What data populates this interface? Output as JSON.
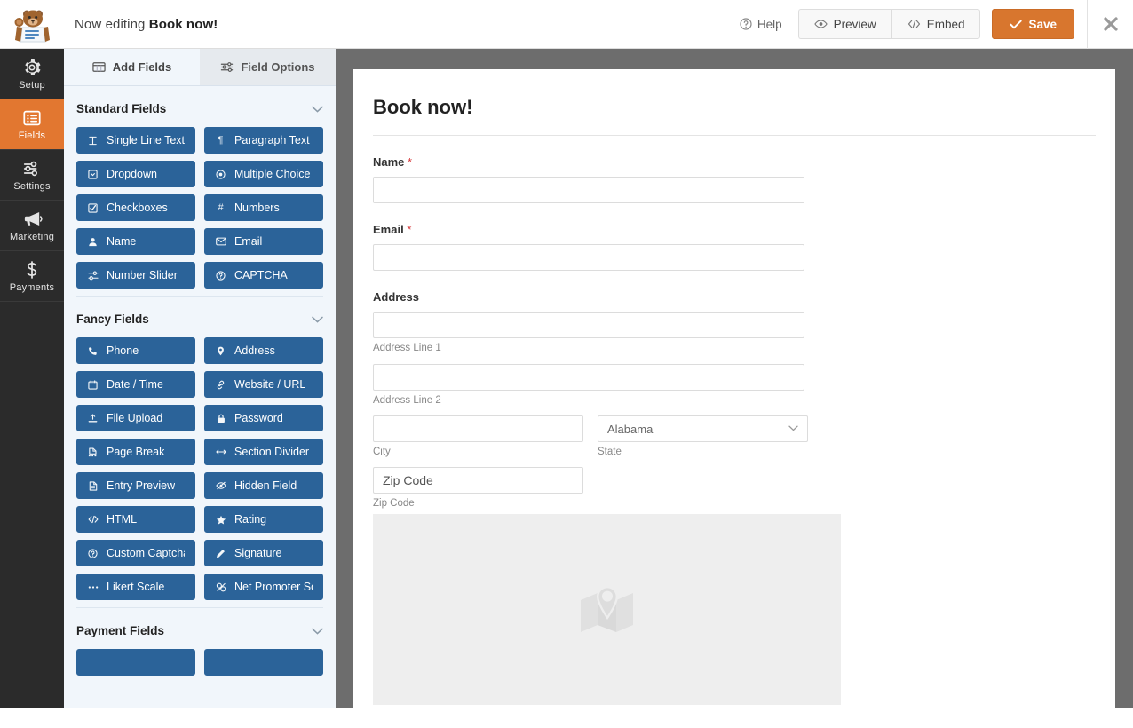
{
  "colors": {
    "accent_orange": "#d8762e",
    "rail_active": "#e27730",
    "field_blue": "#2b6399",
    "panel_bg": "#f1f6fb",
    "gutter_gray": "#6d6d6d",
    "required_red": "#d63638"
  },
  "topbar": {
    "logo_name": "wpforms-sullie-mascot",
    "editing_prefix": "Now editing",
    "form_name": "Book now!",
    "help_label": "Help",
    "preview_label": "Preview",
    "embed_label": "Embed",
    "save_label": "Save",
    "close_label": "✖"
  },
  "rail": {
    "items": [
      {
        "label": "Setup",
        "icon": "gear-icon",
        "active": false
      },
      {
        "label": "Fields",
        "icon": "list-icon",
        "active": true
      },
      {
        "label": "Settings",
        "icon": "sliders-icon",
        "active": false
      },
      {
        "label": "Marketing",
        "icon": "megaphone-icon",
        "active": false
      },
      {
        "label": "Payments",
        "icon": "dollar-icon",
        "active": false
      }
    ]
  },
  "panel": {
    "tabs": [
      {
        "label": "Add Fields",
        "icon": "add-fields-icon",
        "active": true
      },
      {
        "label": "Field Options",
        "icon": "sliders-icon",
        "active": false
      }
    ],
    "sections": [
      {
        "title": "Standard Fields",
        "collapse_icon": "chevron-down-icon",
        "fields": [
          {
            "label": "Single Line Text",
            "icon": "text-cursor-icon"
          },
          {
            "label": "Paragraph Text",
            "icon": "pilcrow-icon"
          },
          {
            "label": "Dropdown",
            "icon": "dropdown-icon"
          },
          {
            "label": "Multiple Choice",
            "icon": "radio-icon"
          },
          {
            "label": "Checkboxes",
            "icon": "checkbox-icon"
          },
          {
            "label": "Numbers",
            "icon": "hash-icon"
          },
          {
            "label": "Name",
            "icon": "user-icon"
          },
          {
            "label": "Email",
            "icon": "envelope-icon"
          },
          {
            "label": "Number Slider",
            "icon": "slider-icon"
          },
          {
            "label": "CAPTCHA",
            "icon": "question-circle-icon"
          }
        ]
      },
      {
        "title": "Fancy Fields",
        "collapse_icon": "chevron-down-icon",
        "fields": [
          {
            "label": "Phone",
            "icon": "phone-icon"
          },
          {
            "label": "Address",
            "icon": "map-pin-icon"
          },
          {
            "label": "Date / Time",
            "icon": "calendar-icon"
          },
          {
            "label": "Website / URL",
            "icon": "link-icon"
          },
          {
            "label": "File Upload",
            "icon": "upload-icon"
          },
          {
            "label": "Password",
            "icon": "lock-icon"
          },
          {
            "label": "Page Break",
            "icon": "page-break-icon"
          },
          {
            "label": "Section Divider",
            "icon": "arrows-horizontal-icon"
          },
          {
            "label": "Entry Preview",
            "icon": "document-icon"
          },
          {
            "label": "Hidden Field",
            "icon": "eye-slash-icon"
          },
          {
            "label": "HTML",
            "icon": "code-icon"
          },
          {
            "label": "Rating",
            "icon": "star-icon"
          },
          {
            "label": "Custom Captcha",
            "icon": "question-circle-icon"
          },
          {
            "label": "Signature",
            "icon": "pen-icon"
          },
          {
            "label": "Likert Scale",
            "icon": "dots-icon"
          },
          {
            "label": "Net Promoter Score",
            "icon": "nps-icon"
          }
        ]
      },
      {
        "title": "Payment Fields",
        "collapse_icon": "chevron-down-icon",
        "fields": [
          {
            "label": "",
            "icon": ""
          },
          {
            "label": "",
            "icon": ""
          }
        ]
      }
    ]
  },
  "preview": {
    "form_title": "Book now!",
    "fields": [
      {
        "type": "name",
        "label": "Name",
        "required": true,
        "value": "",
        "sub_label": ""
      },
      {
        "type": "email",
        "label": "Email",
        "required": true,
        "value": "",
        "sub_label": ""
      }
    ],
    "address": {
      "label": "Address",
      "required": false,
      "line1_value": "",
      "line1_sub_label": "Address Line 1",
      "line2_value": "",
      "line2_sub_label": "Address Line 2",
      "city_value": "",
      "city_sub_label": "City",
      "state_value": "Alabama",
      "state_sub_label": "State",
      "state_icon": "chevron-down-icon",
      "zip_value": "Zip Code",
      "zip_sub_label": "Zip Code"
    },
    "map_placeholder": {
      "icon": "map-with-pin-icon",
      "label": ""
    }
  }
}
